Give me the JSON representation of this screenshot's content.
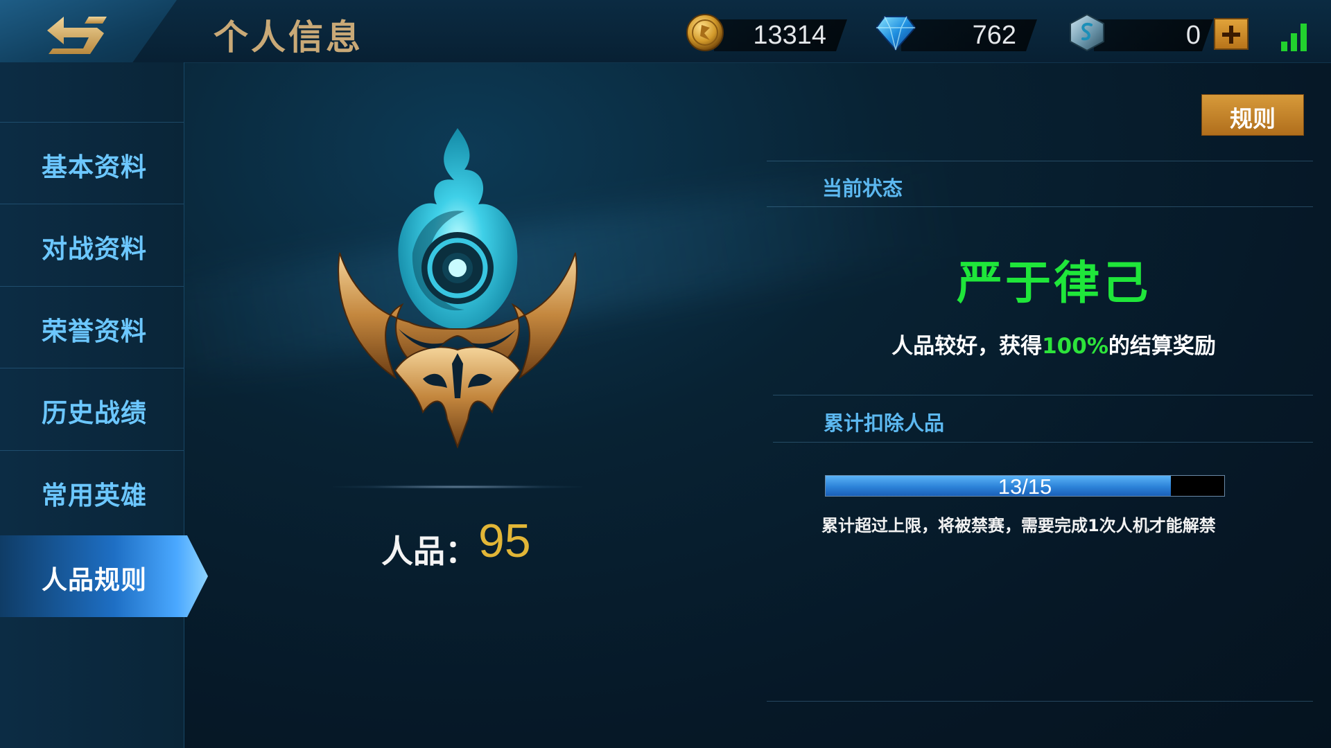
{
  "header": {
    "title": "个人信息",
    "currencies": [
      {
        "name": "gold",
        "icon": "gold-coin-icon",
        "value": "13314"
      },
      {
        "name": "diamond",
        "icon": "diamond-icon",
        "value": "762"
      },
      {
        "name": "voucher",
        "icon": "voucher-coin-icon",
        "value": "0"
      }
    ],
    "signal_icon": "signal-strength-icon"
  },
  "sidebar": {
    "items": [
      {
        "label": "基本资料",
        "active": false
      },
      {
        "label": "对战资料",
        "active": false
      },
      {
        "label": "荣誉资料",
        "active": false
      },
      {
        "label": "历史战绩",
        "active": false
      },
      {
        "label": "常用英雄",
        "active": false
      },
      {
        "label": "人品规则",
        "active": true
      }
    ]
  },
  "main": {
    "emblem_icon": "credit-emblem-icon",
    "credit_label": "人品：",
    "credit_value": "95",
    "rules_button": "规则",
    "current_status_heading": "当前状态",
    "status_title": "严于律己",
    "status_desc_prefix": "人品较好，获得",
    "status_desc_percent": "100%",
    "status_desc_suffix": "的结算奖励",
    "deduction_heading": "累计扣除人品",
    "deduction_progress": {
      "current": 13,
      "max": 15,
      "text": "13/15"
    },
    "deduction_note": "累计超过上限，将被禁赛，需要完成1次人机才能解禁"
  },
  "colors": {
    "accent_blue": "#5cb8f0",
    "status_green": "#1fe63a",
    "credit_gold": "#e2b637",
    "title_gold": "#c9a977"
  }
}
